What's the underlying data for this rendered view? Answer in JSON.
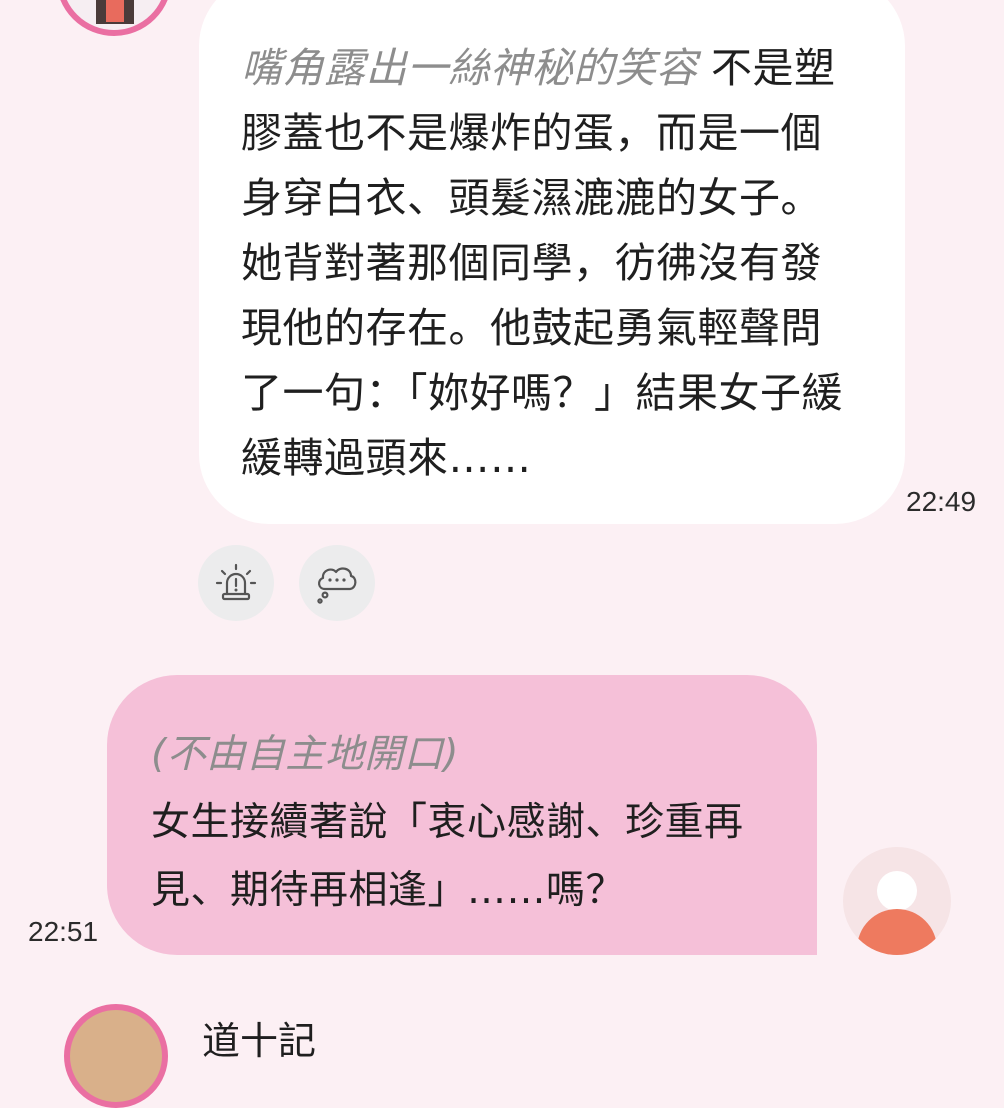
{
  "bot_message": {
    "italic_text": "嘴角露出一絲神秘的笑容",
    "lines": [
      " 不是塑",
      "膠蓋也不是爆炸的蛋，而是一個",
      "身穿白衣、頭髮濕漉漉的女子。",
      "她背對著那個同學，彷彿沒有發",
      "現他的存在。他鼓起勇氣輕聲問",
      "了一句：「妳好嗎？」結果女子緩",
      "緩轉過頭來……"
    ],
    "time": "22:49"
  },
  "action_buttons": [
    {
      "icon": "alarm-icon"
    },
    {
      "icon": "thought-bubble-icon"
    }
  ],
  "user_message": {
    "italic_text": "(不由自主地開口)",
    "lines": [
      "女生接續著說「衷心感謝、珍重再",
      "見、期待再相逢」……嗎？"
    ],
    "time": "22:51"
  },
  "next_message": {
    "name_partial": "道十記"
  },
  "colors": {
    "background": "#fcf0f4",
    "bot_bubble": "#ffffff",
    "user_bubble": "#f5c0d8",
    "avatar_ring": "#ea6fa2",
    "user_avatar_body": "#ee7a5f"
  }
}
